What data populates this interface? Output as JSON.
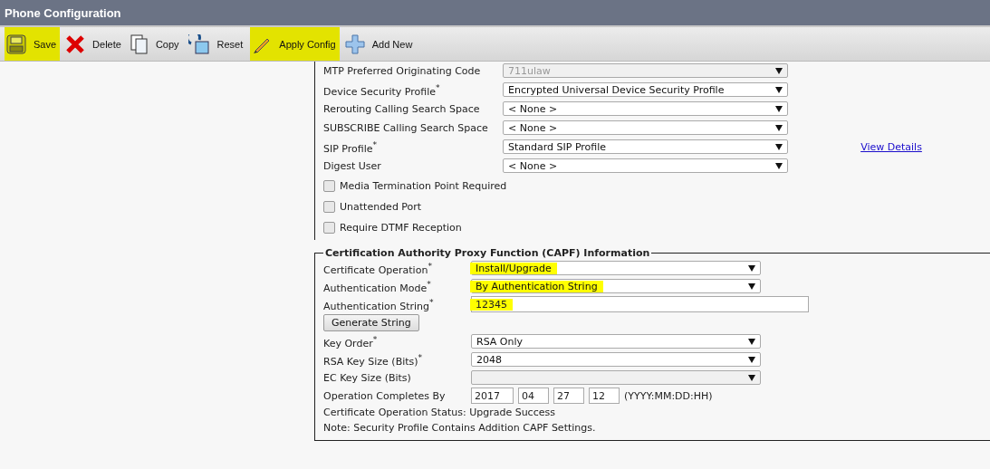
{
  "window": {
    "title": "Phone Configuration"
  },
  "toolbar": [
    {
      "kind": "save",
      "label": "Save",
      "highlighted": true
    },
    {
      "kind": "delete",
      "label": "Delete",
      "highlighted": false
    },
    {
      "kind": "copy",
      "label": "Copy",
      "highlighted": false
    },
    {
      "kind": "reset",
      "label": "Reset",
      "highlighted": false
    },
    {
      "kind": "apply",
      "label": "Apply Config",
      "highlighted": true
    },
    {
      "kind": "add",
      "label": "Add New",
      "highlighted": false
    }
  ],
  "device_section": {
    "fields": [
      {
        "label": "MTP Preferred Originating Code",
        "value": "711ulaw",
        "disabled": true
      },
      {
        "label": "Device Security Profile",
        "required_mark": "*",
        "value": "Encrypted Universal Device Security Profile",
        "disabled": false
      },
      {
        "label": "Rerouting Calling Search Space",
        "value": "< None >",
        "disabled": false
      },
      {
        "label": "SUBSCRIBE Calling Search Space",
        "value": "< None >",
        "disabled": false
      },
      {
        "label": "SIP Profile",
        "required_mark": "*",
        "value": "Standard SIP Profile",
        "disabled": false,
        "link": "View Details"
      },
      {
        "label": "Digest User",
        "value": "< None >",
        "disabled": false
      }
    ],
    "checkboxes": [
      {
        "label": "Media Termination Point Required",
        "checked": false
      },
      {
        "label": "Unattended Port",
        "checked": false
      },
      {
        "label": "Require DTMF Reception",
        "checked": false
      }
    ]
  },
  "capf_section": {
    "title": "Certification Authority Proxy Function (CAPF) Information",
    "fields": [
      {
        "kind": "select",
        "label": "Certificate Operation",
        "required_mark": "*",
        "value": "Install/Upgrade",
        "highlighted": true,
        "disabled": false
      },
      {
        "kind": "select",
        "label": "Authentication Mode",
        "required_mark": "*",
        "value": "By Authentication String",
        "highlighted": true,
        "disabled": false
      },
      {
        "kind": "text",
        "label": "Authentication String",
        "required_mark": "*",
        "value": "12345",
        "highlighted": true
      },
      {
        "kind": "button",
        "label": "Generate String"
      },
      {
        "kind": "select",
        "label": "Key Order",
        "required_mark": "*",
        "value": "RSA Only",
        "highlighted": false,
        "disabled": false
      },
      {
        "kind": "select",
        "label": "RSA Key Size (Bits)",
        "required_mark": "*",
        "value": "2048",
        "highlighted": false,
        "disabled": false
      },
      {
        "kind": "select",
        "label": "EC Key Size (Bits)",
        "disabled": true
      },
      {
        "kind": "date",
        "label": "Operation Completes By",
        "parts": [
          "2017",
          "04",
          "27",
          "12"
        ],
        "hint": "(YYYY:MM:DD:HH)"
      }
    ],
    "notes": [
      "Certificate Operation Status: Upgrade Success",
      "Note: Security Profile Contains Addition CAPF Settings."
    ]
  }
}
